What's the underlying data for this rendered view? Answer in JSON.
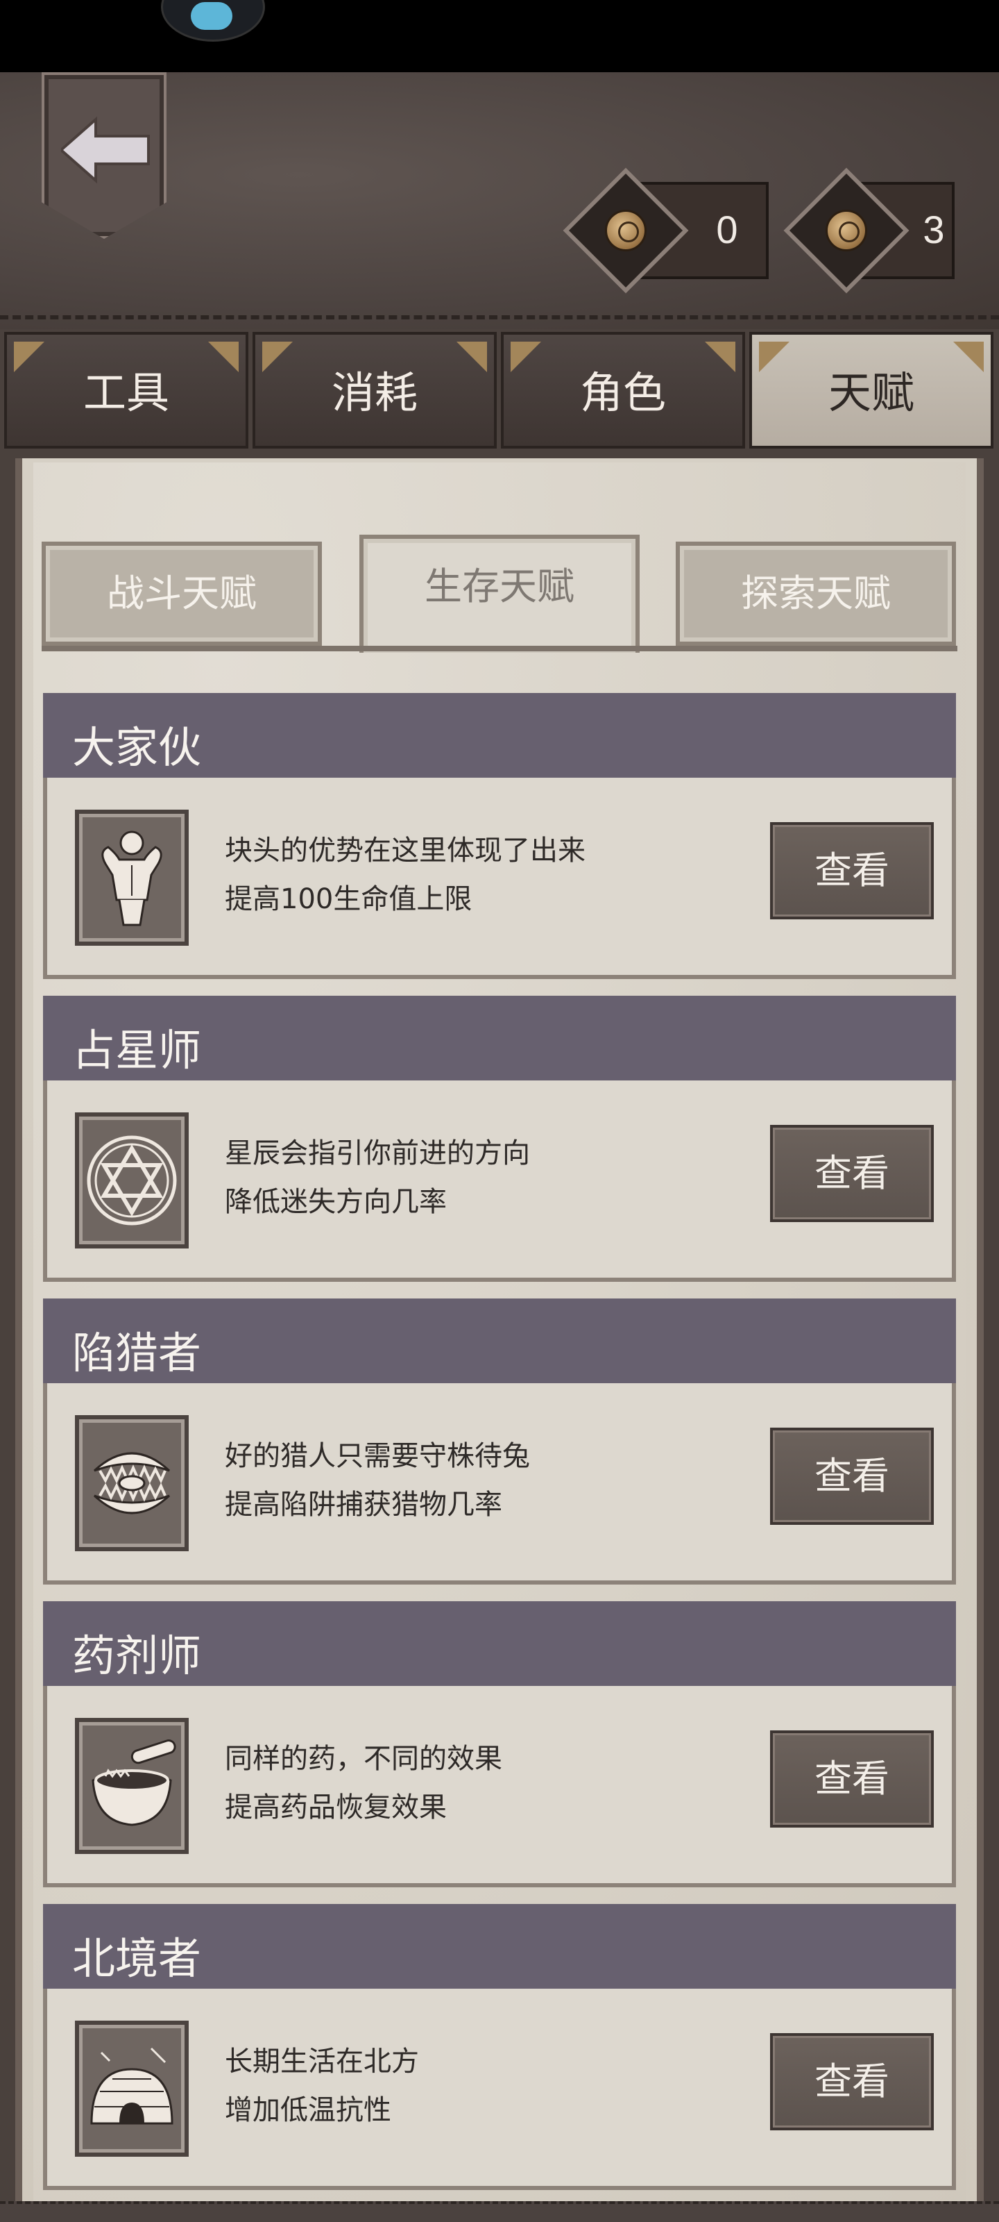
{
  "currencies": [
    {
      "value": "0",
      "icon": "coin-icon"
    },
    {
      "value": "3",
      "icon": "coin-icon"
    }
  ],
  "main_tabs": [
    {
      "label": "工具"
    },
    {
      "label": "消耗"
    },
    {
      "label": "角色"
    },
    {
      "label": "天赋",
      "active": true
    }
  ],
  "sub_tabs": [
    {
      "label": "战斗天赋"
    },
    {
      "label": "生存天赋",
      "active": true
    },
    {
      "label": "探索天赋"
    }
  ],
  "talents": [
    {
      "name": "大家伙",
      "line1": "块头的优势在这里体现了出来",
      "line2": "提高100生命值上限",
      "icon": "muscle-man-icon",
      "button": "查看"
    },
    {
      "name": "占星师",
      "line1": "星辰会指引你前进的方向",
      "line2": "降低迷失方向几率",
      "icon": "hexagram-icon",
      "button": "查看"
    },
    {
      "name": "陷猎者",
      "line1": "好的猎人只需要守株待兔",
      "line2": "提高陷阱捕获猎物几率",
      "icon": "bear-trap-icon",
      "button": "查看"
    },
    {
      "name": "药剂师",
      "line1": "同样的药，不同的效果",
      "line2": "提高药品恢复效果",
      "icon": "mortar-pestle-icon",
      "button": "查看"
    },
    {
      "name": "北境者",
      "line1": "长期生活在北方",
      "line2": "增加低温抗性",
      "icon": "igloo-icon",
      "button": "查看"
    }
  ],
  "colors": {
    "leather": "#4c4340",
    "title_bar": "#67606f",
    "parchment": "#ddd8cf",
    "button": "#5c534e"
  }
}
